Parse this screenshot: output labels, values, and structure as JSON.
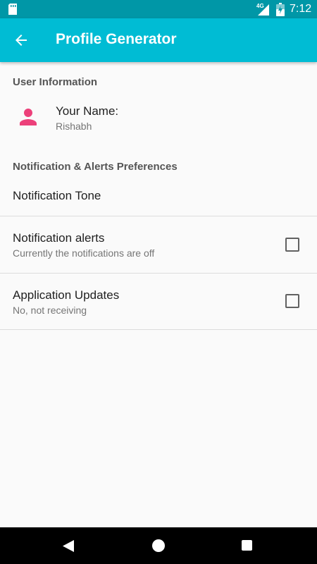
{
  "status_bar": {
    "network": "4G",
    "time": "7:12",
    "icons": [
      "sd-card-icon",
      "signal-icon",
      "battery-icon"
    ]
  },
  "app_bar": {
    "title": "Profile Generator",
    "back_icon": "arrow-back-icon"
  },
  "sections": {
    "user_info": {
      "header": "User Information",
      "name_label": "Your Name:",
      "name_value": "Rishabh",
      "avatar_icon": "person-icon",
      "avatar_color": "#ec407a"
    },
    "notifications": {
      "header": "Notification & Alerts Preferences",
      "tone_label": "Notification Tone",
      "alerts_label": "Notification alerts",
      "alerts_summary": "Currently the notifications are off",
      "alerts_checked": false,
      "updates_label": "Application Updates",
      "updates_summary": "No, not receiving",
      "updates_checked": false
    }
  },
  "nav_bar": {
    "icons": [
      "nav-back-icon",
      "nav-home-icon",
      "nav-recents-icon"
    ]
  },
  "colors": {
    "status_bar": "#0097a7",
    "app_bar": "#00bcd4",
    "background": "#fafafa"
  }
}
